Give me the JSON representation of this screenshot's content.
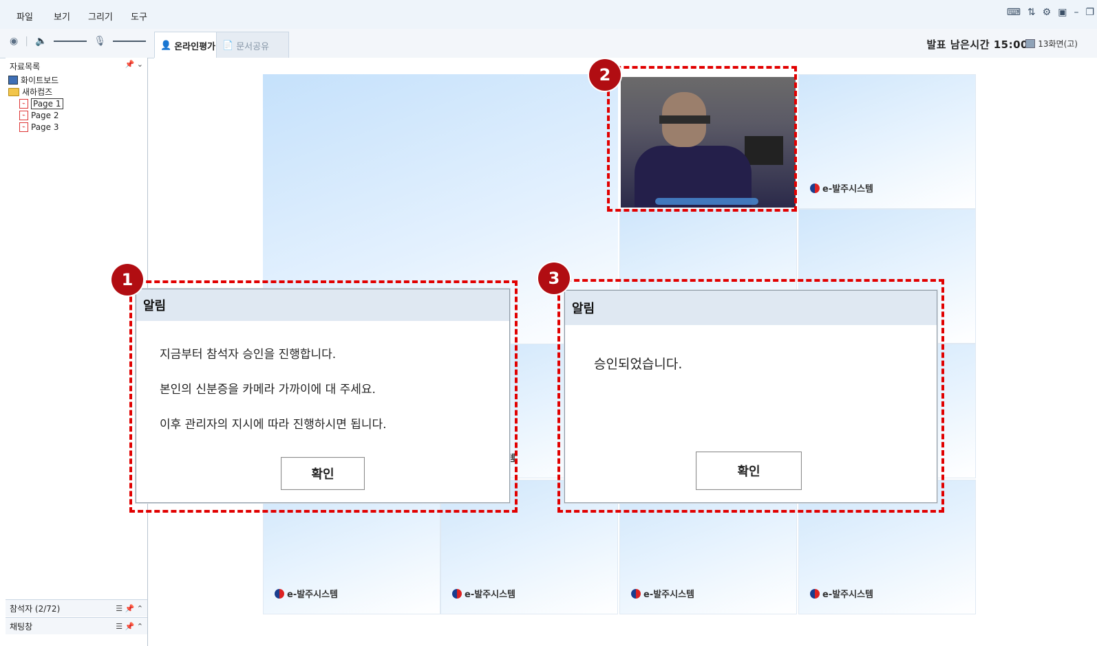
{
  "menubar": {
    "items": [
      "파일",
      "보기",
      "그리기",
      "도구"
    ]
  },
  "toolbar": {
    "tabs": [
      {
        "label": "온라인평가",
        "active": true
      },
      {
        "label": "문서공유",
        "active": false
      }
    ],
    "timer_label": "발표 남은시간 15:00",
    "screen_mode": "13화면(고)"
  },
  "sidebar": {
    "title": "자료목록",
    "tree": [
      {
        "label": "화이트보드",
        "type": "whiteboard"
      },
      {
        "label": "새하컴즈",
        "type": "folder"
      },
      {
        "label": "Page 1",
        "type": "pdf",
        "selected": true
      },
      {
        "label": "Page 2",
        "type": "pdf"
      },
      {
        "label": "Page 3",
        "type": "pdf"
      }
    ],
    "participants_label": "참석자 (2/72)",
    "chat_label": "채팅창"
  },
  "stage": {
    "tile_logo_text": "e-발주시스템"
  },
  "dialogs": [
    {
      "title": "알림",
      "lines": [
        "지금부터 참석자 승인을 진행합니다.",
        "본인의 신분증을 카메라 가까이에 대 주세요.",
        "이후 관리자의 지시에 따라 진행하시면 됩니다."
      ],
      "ok_label": "확인"
    },
    {
      "title": "알림",
      "lines": [
        "승인되었습니다."
      ],
      "ok_label": "확인"
    }
  ],
  "annotations": [
    "1",
    "2",
    "3"
  ],
  "colors": {
    "annotation": "#e10000",
    "badge": "#b10d12",
    "title_bar": "#dfe8f2"
  }
}
